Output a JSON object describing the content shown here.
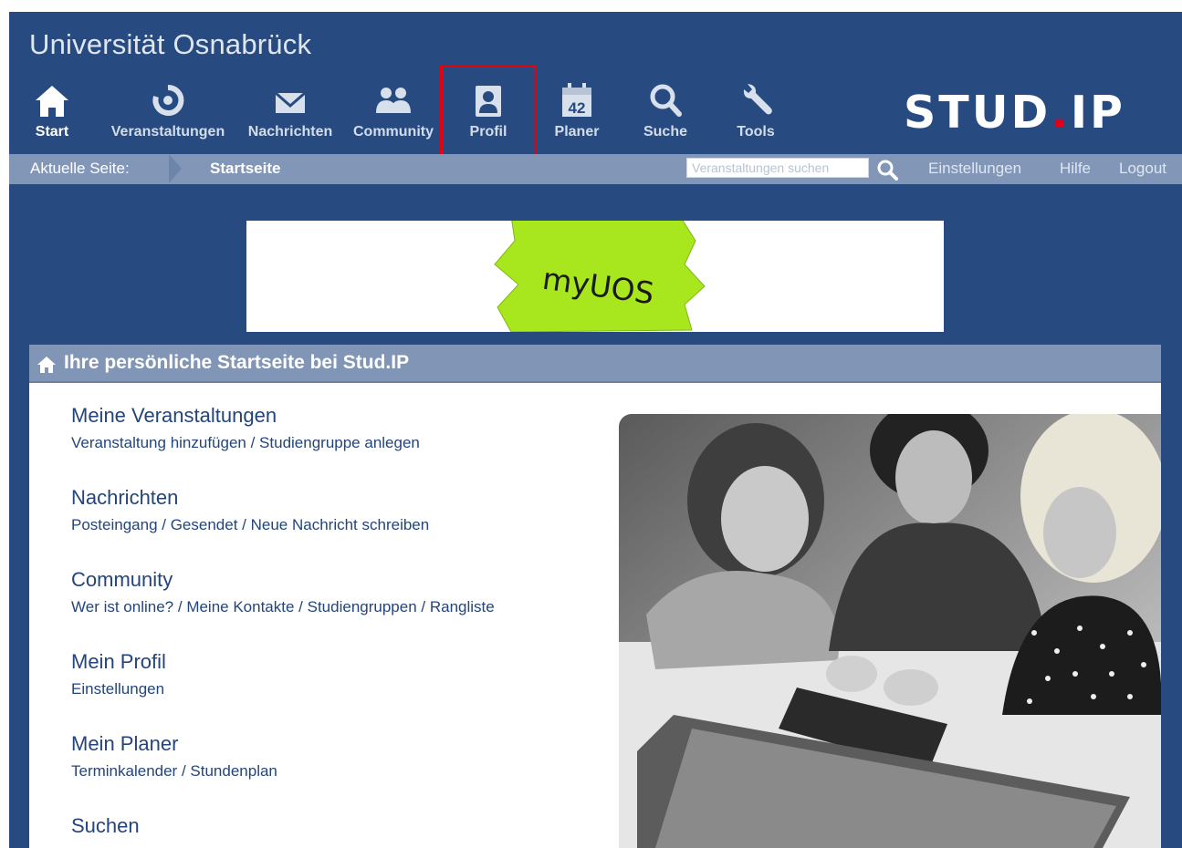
{
  "header": {
    "title": "Universität Osnabrück",
    "logo_main": "STUD",
    "logo_dot": ".",
    "logo_suffix": "IP"
  },
  "nav": [
    {
      "label": "Start",
      "icon": "home-icon",
      "active": true
    },
    {
      "label": "Veranstaltungen",
      "icon": "courses-icon",
      "active": false
    },
    {
      "label": "Nachrichten",
      "icon": "mail-icon",
      "active": false
    },
    {
      "label": "Community",
      "icon": "community-icon",
      "active": false
    },
    {
      "label": "Profil",
      "icon": "profile-icon",
      "active": false
    },
    {
      "label": "Planer",
      "icon": "calendar-icon",
      "active": false,
      "icon_text": "42"
    },
    {
      "label": "Suche",
      "icon": "search-icon",
      "active": false
    },
    {
      "label": "Tools",
      "icon": "wrench-icon",
      "active": false
    }
  ],
  "breadcrumb": {
    "label": "Aktuelle Seite:",
    "current": "Startseite"
  },
  "search": {
    "placeholder": "Veranstaltungen suchen"
  },
  "toplinks": {
    "settings": "Einstellungen",
    "help": "Hilfe",
    "logout": "Logout"
  },
  "banner": {
    "text": "myUOS"
  },
  "panel": {
    "title": "Ihre persönliche Startseite bei Stud.IP"
  },
  "sections": [
    {
      "heading": "Meine Veranstaltungen",
      "links": [
        "Veranstaltung hinzufügen",
        "Studiengruppe anlegen"
      ]
    },
    {
      "heading": "Nachrichten",
      "links": [
        "Posteingang",
        "Gesendet",
        "Neue Nachricht schreiben"
      ]
    },
    {
      "heading": "Community",
      "links": [
        "Wer ist online?",
        "Meine Kontakte",
        "Studiengruppen",
        "Rangliste"
      ]
    },
    {
      "heading": "Mein Profil",
      "links": [
        "Einstellungen"
      ]
    },
    {
      "heading": "Mein Planer",
      "links": [
        "Terminkalender",
        "Stundenplan"
      ]
    },
    {
      "heading": "Suchen",
      "links": []
    }
  ],
  "colors": {
    "header_bg": "#274b80",
    "breadcrumb_bg": "#8297b8",
    "panel_head_bg": "#8196b6",
    "link": "#24457a",
    "highlight": "#e8000b",
    "banner_green": "#a8e61d"
  }
}
